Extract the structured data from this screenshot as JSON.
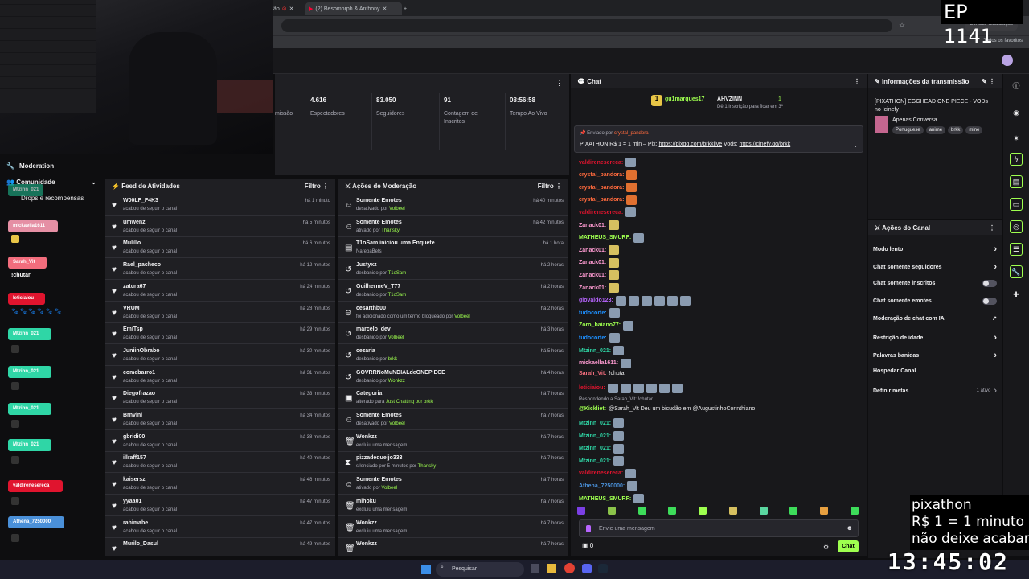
{
  "browser": {
    "tabs": [
      "ão",
      "(2) Besomorph & Anthony"
    ],
    "update_btn": "Concluir atualização",
    "bookmarks_all": "Todos os favoritos"
  },
  "overlay": {
    "episode": "EP 1141",
    "pix_title": "pixathon",
    "pix_line1": "R$ 1 = 1 minuto",
    "pix_line2": "não deixe acabar",
    "clock": "13:45:02"
  },
  "sidebar": {
    "moderation": "Moderation",
    "community": "Comunidade",
    "drops": "Drops e recompensas",
    "pills": [
      {
        "name": "Mtzinn_021",
        "color": "#1b9e7a"
      },
      {
        "name": "mickaella1611",
        "color": "#e58fa4"
      },
      {
        "name": "Sarah_Vit",
        "color": "#f26d7d"
      },
      {
        "name": "leticiaiou",
        "color": "#e0142e"
      },
      {
        "name": "Mtzinn_021",
        "color": "#2fd6a6"
      },
      {
        "name": "Mtzinn_021",
        "color": "#2fd6a6"
      },
      {
        "name": "Mtzinn_021",
        "color": "#2fd6a6"
      },
      {
        "name": "Mtzinn_021",
        "color": "#2fd6a6"
      },
      {
        "name": "valdirenesereca",
        "color": "#e0142e"
      },
      {
        "name": "Athena_7250000",
        "color": "#4a90d9"
      }
    ],
    "chutar": "!chutar"
  },
  "stats": {
    "partial_label": "missão",
    "items": [
      {
        "value": "4.616",
        "label": "Espectadores"
      },
      {
        "value": "83.050",
        "label": "Seguidores"
      },
      {
        "value": "91",
        "label": "Contagem de Inscritos"
      },
      {
        "value": "08:56:58",
        "label": "Tempo Ao Vivo"
      }
    ]
  },
  "feed": {
    "title": "Feed de Atividades",
    "filter": "Filtro",
    "rows": [
      {
        "user": "W00LF_F4K3",
        "action": "acabou de seguir o canal",
        "time": "há 1 minuto"
      },
      {
        "user": "umwenz",
        "action": "acabou de seguir o canal",
        "time": "há 5 minutos"
      },
      {
        "user": "Mulillo",
        "action": "acabou de seguir o canal",
        "time": "há 6 minutos"
      },
      {
        "user": "Rael_pacheco",
        "action": "acabou de seguir o canal",
        "time": "há 12 minutos"
      },
      {
        "user": "zatura67",
        "action": "acabou de seguir o canal",
        "time": "há 24 minutos"
      },
      {
        "user": "VRUM",
        "action": "acabou de seguir o canal",
        "time": "há 28 minutos"
      },
      {
        "user": "EmiTsp",
        "action": "acabou de seguir o canal",
        "time": "há 29 minutos"
      },
      {
        "user": "JuniinObrabo",
        "action": "acabou de seguir o canal",
        "time": "há 30 minutos"
      },
      {
        "user": "comebarro1",
        "action": "acabou de seguir o canal",
        "time": "há 31 minutos"
      },
      {
        "user": "Diegofrazao",
        "action": "acabou de seguir o canal",
        "time": "há 33 minutos"
      },
      {
        "user": "Brnvini",
        "action": "acabou de seguir o canal",
        "time": "há 34 minutos"
      },
      {
        "user": "gbridi00",
        "action": "acabou de seguir o canal",
        "time": "há 38 minutos"
      },
      {
        "user": "illraff157",
        "action": "acabou de seguir o canal",
        "time": "há 40 minutos"
      },
      {
        "user": "kaisersz",
        "action": "acabou de seguir o canal",
        "time": "há 46 minutos"
      },
      {
        "user": "yyaa01",
        "action": "acabou de seguir o canal",
        "time": "há 47 minutos"
      },
      {
        "user": "rahimabe",
        "action": "acabou de seguir o canal",
        "time": "há 47 minutos"
      },
      {
        "user": "Murilo_Dasul",
        "action": "",
        "time": "há 49 minutos"
      }
    ]
  },
  "modactions": {
    "title": "Ações de Moderação",
    "filter": "Filtro",
    "rows": [
      {
        "icon": "☺",
        "title": "Somente Emotes",
        "pre": "desativado por ",
        "who": "Volbeel",
        "time": "há 40 minutos"
      },
      {
        "icon": "☺",
        "title": "Somente Emotes",
        "pre": "ativado por ",
        "who": "Tharisky",
        "time": "há 42 minutos"
      },
      {
        "icon": "▤",
        "title": "T1oSam iniciou uma Enquete",
        "pre": "NarebaBets",
        "who": "",
        "time": "há 1 hora"
      },
      {
        "icon": "↺",
        "title": "Justyxz",
        "pre": "desbanido por ",
        "who": "T1oSam",
        "time": "há 2 horas"
      },
      {
        "icon": "↺",
        "title": "GuilhermeV_T77",
        "pre": "desbanido por ",
        "who": "T1oSam",
        "time": "há 2 horas"
      },
      {
        "icon": "⊖",
        "title": "cesarthb00",
        "pre": "foi adicionado como um termo bloqueado por ",
        "who": "Volbeel",
        "time": "há 2 horas"
      },
      {
        "icon": "↺",
        "title": "marcelo_dev",
        "pre": "desbanido por ",
        "who": "Volbeel",
        "time": "há 3 horas"
      },
      {
        "icon": "↺",
        "title": "cezaria",
        "pre": "desbanido por ",
        "who": "brkk",
        "time": "há 5 horas"
      },
      {
        "icon": "↺",
        "title": "GOVRRNoMuNDIALdeONEPIECE",
        "pre": "desbanido por ",
        "who": "Wonkzz",
        "time": "há 4 horas"
      },
      {
        "icon": "▣",
        "title": "Categoria",
        "pre": "alterado para ",
        "who": "Just Chatting por brkk",
        "time": "há 7 horas"
      },
      {
        "icon": "☺",
        "title": "Somente Emotes",
        "pre": "desativado por ",
        "who": "Volbeel",
        "time": "há 7 horas"
      },
      {
        "icon": "🗑",
        "title": "Wonkzz",
        "pre": "excluiu uma mensagem",
        "who": "",
        "time": "há 7 horas"
      },
      {
        "icon": "⧗",
        "title": "pizzadequeijo333",
        "pre": "silenciado por 5 minutos por ",
        "who": "Tharisky",
        "time": "há 7 horas"
      },
      {
        "icon": "☺",
        "title": "Somente Emotes",
        "pre": "ativado por ",
        "who": "Volbeel",
        "time": "há 7 horas"
      },
      {
        "icon": "🗑",
        "title": "mihoku",
        "pre": "excluiu uma mensagem",
        "who": "",
        "time": "há 7 horas"
      },
      {
        "icon": "🗑",
        "title": "Wonkzz",
        "pre": "excluiu uma mensagem",
        "who": "",
        "time": "há 7 horas"
      },
      {
        "icon": "🗑",
        "title": "Wonkzz",
        "pre": "",
        "who": "",
        "time": "há 7 horas"
      }
    ]
  },
  "chat": {
    "title": "Chat",
    "top_user": "gu1marques17",
    "top_user2": "AHVZINN",
    "top_count1": "1",
    "top_count2": "1",
    "top_sub": "Dê 1 inscrição para ficar em 3º",
    "pinned_by": "Enviado por",
    "pinned_user": "crystal_pandora",
    "pinned_text": "PIXATHON R$ 1 = 1 min – Pix:",
    "pinned_link1": "https://pixgg.com/brkklive",
    "pinned_mid": "Vods:",
    "pinned_link2": "https://cinefy.gg/brkk",
    "lines": [
      {
        "user": "valdirenesereca:",
        "color": "#e0142e",
        "text": ""
      },
      {
        "user": "crystal_pandora:",
        "color": "#ff6a3d",
        "text": ""
      },
      {
        "user": "crystal_pandora:",
        "color": "#ff6a3d",
        "text": ""
      },
      {
        "user": "crystal_pandora:",
        "color": "#ff6a3d",
        "text": ""
      },
      {
        "user": "valdirenesereca:",
        "color": "#e0142e",
        "text": ""
      },
      {
        "user": "Zanack01:",
        "color": "#ff9bd2",
        "text": ""
      },
      {
        "user": "MATHEUS_SMURF:",
        "color": "#9eff4f",
        "text": ""
      },
      {
        "user": "Zanack01:",
        "color": "#ff9bd2",
        "text": ""
      },
      {
        "user": "Zanack01:",
        "color": "#ff9bd2",
        "text": ""
      },
      {
        "user": "Zanack01:",
        "color": "#ff9bd2",
        "text": ""
      },
      {
        "user": "Zanack01:",
        "color": "#ff9bd2",
        "text": ""
      },
      {
        "user": "giovaldo123:",
        "color": "#b865ff",
        "text": ""
      },
      {
        "user": "tudocorte:",
        "color": "#1e90ff",
        "text": ""
      },
      {
        "user": "Zoro_baiano77:",
        "color": "#9eff4f",
        "text": ""
      },
      {
        "user": "tudocorte:",
        "color": "#1e90ff",
        "text": ""
      },
      {
        "user": "Mtzinn_021:",
        "color": "#2fd6a6",
        "text": ""
      },
      {
        "user": "mickaella1611:",
        "color": "#ff9bd2",
        "text": ""
      },
      {
        "user": "Sarah_Vit:",
        "color": "#f26d7d",
        "text": "!chutar"
      },
      {
        "user": "leticiaiou:",
        "color": "#e0142e",
        "text": ""
      }
    ],
    "reply_to": "Respondendo a Sarah_Vit: !chutar",
    "reply_user": "@Kickliet:",
    "reply_text": "@Sarah_Vit Deu um bicudão em @AugustinhoCorinthiano",
    "lines2": [
      {
        "user": "Mtzinn_021:",
        "color": "#2fd6a6"
      },
      {
        "user": "Mtzinn_021:",
        "color": "#2fd6a6"
      },
      {
        "user": "Mtzinn_021:",
        "color": "#2fd6a6"
      },
      {
        "user": "Mtzinn_021:",
        "color": "#2fd6a6"
      },
      {
        "user": "valdirenesereca:",
        "color": "#e0142e"
      },
      {
        "user": "Athena_7250000:",
        "color": "#4a90d9"
      },
      {
        "user": "MATHEUS_SMURF:",
        "color": "#9eff4f"
      }
    ],
    "input_placeholder": "Envie uma mensagem",
    "points": "0",
    "send": "Chat"
  },
  "info": {
    "title": "Informações da transmissão",
    "stream_title": "[PIXATHON] EGGHEAD ONE PIECE - VODs no !cinefy",
    "category": "Apenas Conversa",
    "tags": [
      "Portuguese",
      "anime",
      "brkk",
      "mine"
    ]
  },
  "actions": {
    "title": "Ações do Canal",
    "items": [
      {
        "label": "Modo lento",
        "ctrl": "chevron"
      },
      {
        "label": "Chat somente seguidores",
        "ctrl": "chevron"
      },
      {
        "label": "Chat somente inscritos",
        "ctrl": "toggle"
      },
      {
        "label": "Chat somente emotes",
        "ctrl": "toggle"
      },
      {
        "label": "Moderação de chat com IA",
        "ctrl": "ext"
      },
      {
        "label": "Restrição de idade",
        "ctrl": "chevron"
      },
      {
        "label": "Palavras banidas",
        "ctrl": "chevron"
      },
      {
        "label": "Hospedar Canal",
        "ctrl": "none"
      },
      {
        "label": "Definir metas",
        "ctrl": "chevron"
      }
    ],
    "metas_badge": "1 ativo"
  },
  "taskbar": {
    "search": "Pesquisar"
  },
  "colors": {
    "accent": "#9eff4f",
    "bg": "#0e0e10",
    "panel": "#1f1f23"
  }
}
